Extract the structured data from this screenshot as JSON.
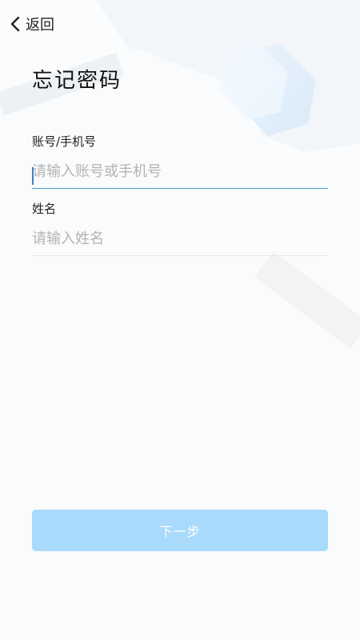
{
  "header": {
    "back_label": "返回"
  },
  "page": {
    "title": "忘记密码"
  },
  "form": {
    "account": {
      "label": "账号/手机号",
      "value": "",
      "placeholder": "请输入账号或手机号"
    },
    "name": {
      "label": "姓名",
      "value": "",
      "placeholder": "请输入姓名"
    }
  },
  "actions": {
    "next_label": "下一步"
  },
  "colors": {
    "primary_disabled": "#a9dafb",
    "focus_underline": "#4a9fd6"
  },
  "icons": {
    "back": "chevron-left-icon"
  }
}
